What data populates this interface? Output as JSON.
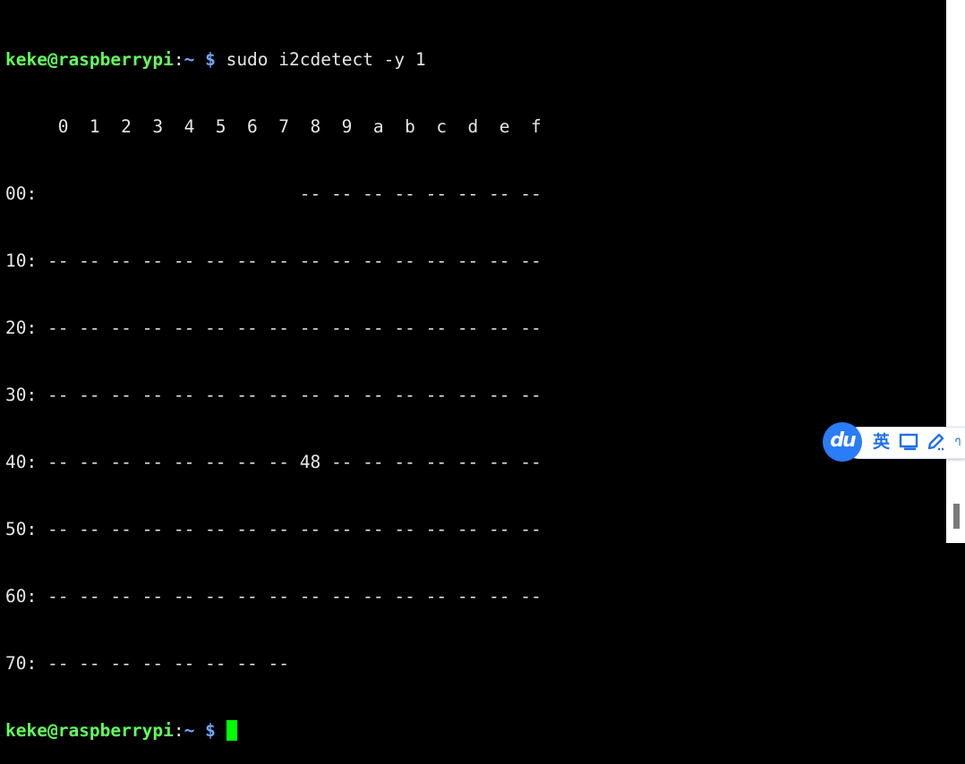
{
  "terminal": {
    "prompt": {
      "user_host": "keke@raspberrypi",
      "sep": ":",
      "path": "~",
      "symbol": " $ "
    },
    "command": "sudo i2cdetect -y 1",
    "output_lines": [
      "     0  1  2  3  4  5  6  7  8  9  a  b  c  d  e  f",
      "00:                         -- -- -- -- -- -- -- --",
      "10: -- -- -- -- -- -- -- -- -- -- -- -- -- -- -- --",
      "20: -- -- -- -- -- -- -- -- -- -- -- -- -- -- -- --",
      "30: -- -- -- -- -- -- -- -- -- -- -- -- -- -- -- --",
      "40: -- -- -- -- -- -- -- -- 48 -- -- -- -- -- -- --",
      "50: -- -- -- -- -- -- -- -- -- -- -- -- -- -- -- --",
      "60: -- -- -- -- -- -- -- -- -- -- -- -- -- -- -- --",
      "70: -- -- -- -- -- -- -- --"
    ]
  },
  "ime": {
    "logo": "du",
    "language": "英",
    "icons": [
      "keyboard-icon",
      "pen-icon",
      "shirt-icon"
    ]
  },
  "colors": {
    "prompt_user": "#62ff5c",
    "prompt_path": "#6fa8ff",
    "cursor": "#00ff00",
    "ime_blue": "#2a7cf7"
  }
}
